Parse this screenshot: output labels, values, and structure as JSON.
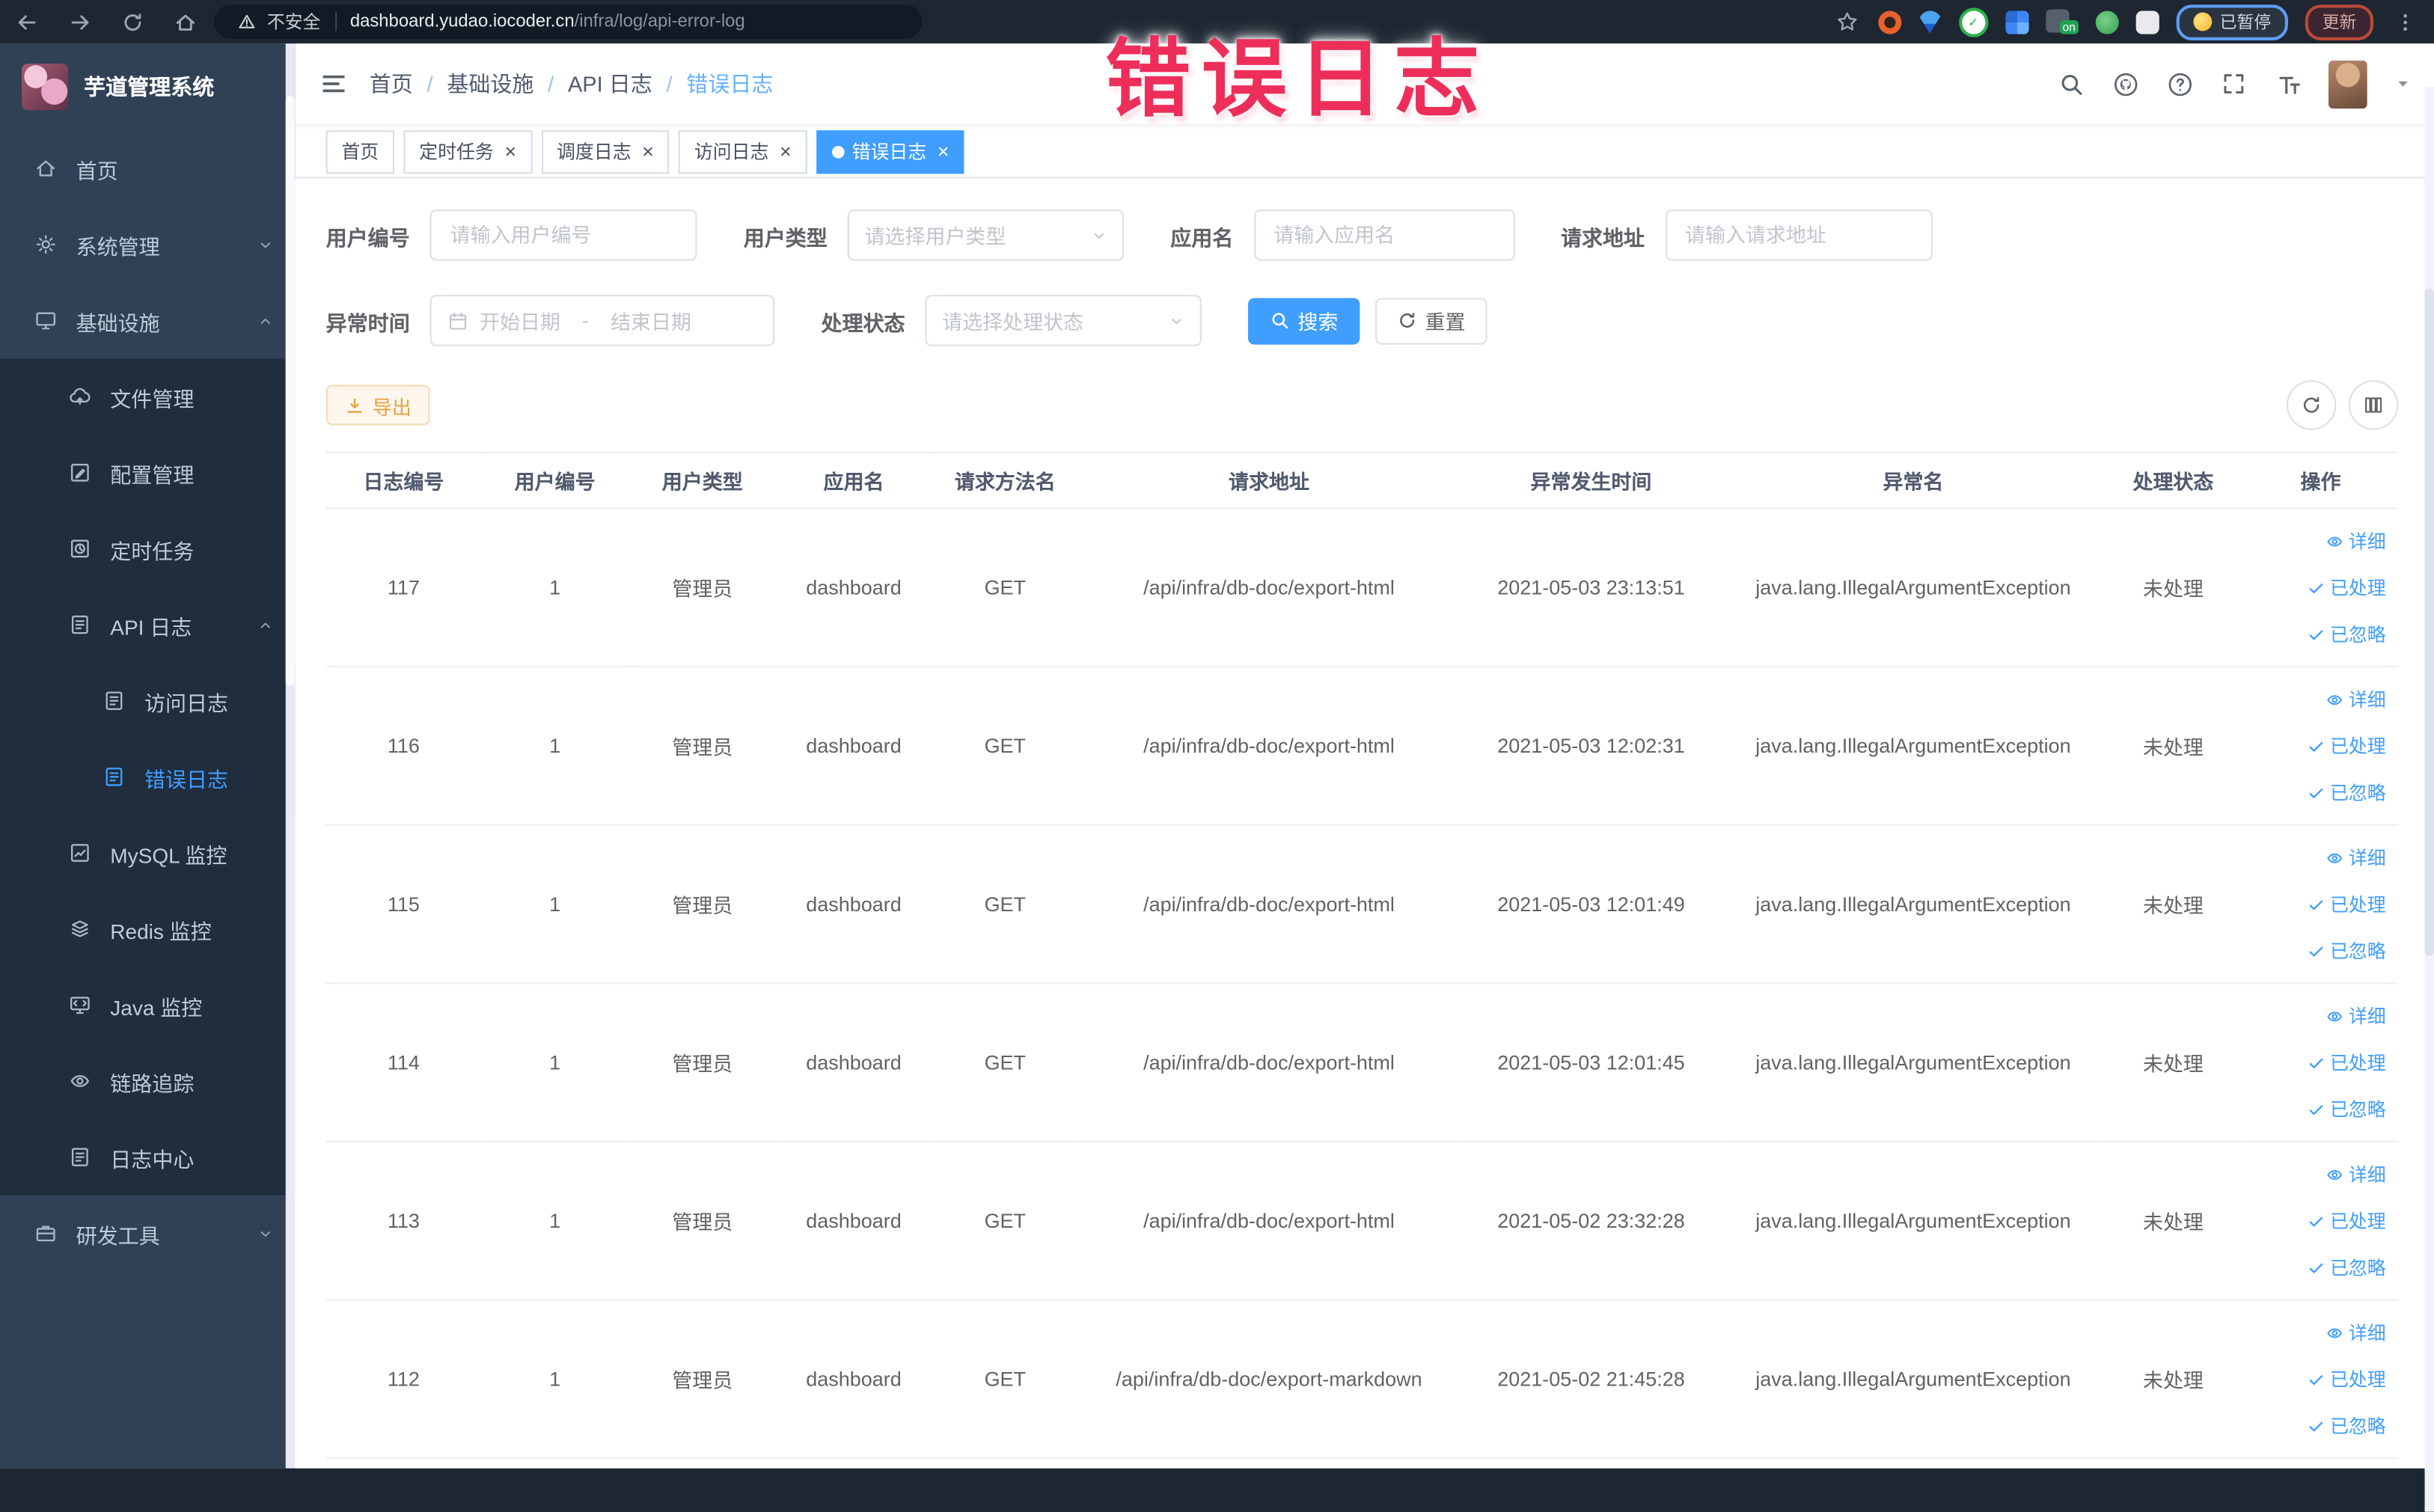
{
  "browser": {
    "security_label": "不安全",
    "url_host": "dashboard.yudao.iocoder.cn",
    "url_path": "/infra/log/api-error-log",
    "paused_button": "已暂停",
    "update_button": "更新",
    "extension_badge": "on"
  },
  "watermark": "错误日志",
  "sidebar": {
    "title": "芋道管理系统",
    "items": [
      {
        "name": "home",
        "icon": "home-icon",
        "label": "首页"
      },
      {
        "name": "system",
        "icon": "gear-icon",
        "label": "系统管理",
        "chevron": "down"
      },
      {
        "name": "infra",
        "icon": "infra-icon",
        "label": "基础设施",
        "chevron": "up",
        "children": [
          {
            "name": "file",
            "icon": "file-icon",
            "label": "文件管理"
          },
          {
            "name": "config",
            "icon": "config-icon",
            "label": "配置管理"
          },
          {
            "name": "job",
            "icon": "job-icon",
            "label": "定时任务"
          },
          {
            "name": "api-log",
            "icon": "api-log-icon",
            "label": "API 日志",
            "chevron": "up",
            "children": [
              {
                "name": "access-log",
                "icon": "access-log-icon",
                "label": "访问日志"
              },
              {
                "name": "error-log",
                "icon": "error-log-icon",
                "label": "错误日志",
                "active": true
              }
            ]
          },
          {
            "name": "mysql",
            "icon": "mysql-icon",
            "label": "MySQL 监控"
          },
          {
            "name": "redis",
            "icon": "redis-icon",
            "label": "Redis 监控"
          },
          {
            "name": "java",
            "icon": "java-icon",
            "label": "Java 监控"
          },
          {
            "name": "trace",
            "icon": "trace-icon",
            "label": "链路追踪"
          },
          {
            "name": "log-center",
            "icon": "log-center-icon",
            "label": "日志中心"
          }
        ]
      },
      {
        "name": "dev-tools",
        "icon": "dev-tools-icon",
        "label": "研发工具",
        "chevron": "down"
      }
    ]
  },
  "header": {
    "breadcrumb": [
      "首页",
      "基础设施",
      "API 日志",
      "错误日志"
    ]
  },
  "tabs": [
    {
      "label": "首页",
      "active": false,
      "closable": false
    },
    {
      "label": "定时任务",
      "active": false,
      "closable": true
    },
    {
      "label": "调度日志",
      "active": false,
      "closable": true
    },
    {
      "label": "访问日志",
      "active": false,
      "closable": true
    },
    {
      "label": "错误日志",
      "active": true,
      "closable": true
    }
  ],
  "filters": {
    "user_id": {
      "label": "用户编号",
      "placeholder": "请输入用户编号"
    },
    "user_type": {
      "label": "用户类型",
      "placeholder": "请选择用户类型"
    },
    "app_name": {
      "label": "应用名",
      "placeholder": "请输入应用名"
    },
    "request_url": {
      "label": "请求地址",
      "placeholder": "请输入请求地址"
    },
    "exception_time": {
      "label": "异常时间",
      "start_placeholder": "开始日期",
      "separator": "-",
      "end_placeholder": "结束日期"
    },
    "status": {
      "label": "处理状态",
      "placeholder": "请选择处理状态"
    },
    "search_button": "搜索",
    "reset_button": "重置",
    "export_button": "导出"
  },
  "table": {
    "headers": [
      "日志编号",
      "用户编号",
      "用户类型",
      "应用名",
      "请求方法名",
      "请求地址",
      "异常发生时间",
      "异常名",
      "处理状态",
      "操作"
    ],
    "action_labels": [
      "详细",
      "已处理",
      "已忽略"
    ],
    "rows": [
      {
        "id": "117",
        "user_id": "1",
        "user_type": "管理员",
        "app_name": "dashboard",
        "method": "GET",
        "url": "/api/infra/db-doc/export-html",
        "time": "2021-05-03 23:13:51",
        "exception": "java.lang.IllegalArgumentException",
        "status": "未处理",
        "actions": [
          "详细",
          "已处理",
          "已忽略"
        ]
      },
      {
        "id": "116",
        "user_id": "1",
        "user_type": "管理员",
        "app_name": "dashboard",
        "method": "GET",
        "url": "/api/infra/db-doc/export-html",
        "time": "2021-05-03 12:02:31",
        "exception": "java.lang.IllegalArgumentException",
        "status": "未处理",
        "actions": [
          "详细",
          "已处理",
          "已忽略"
        ]
      },
      {
        "id": "115",
        "user_id": "1",
        "user_type": "管理员",
        "app_name": "dashboard",
        "method": "GET",
        "url": "/api/infra/db-doc/export-html",
        "time": "2021-05-03 12:01:49",
        "exception": "java.lang.IllegalArgumentException",
        "status": "未处理",
        "actions": [
          "详细",
          "已处理",
          "已忽略"
        ]
      },
      {
        "id": "114",
        "user_id": "1",
        "user_type": "管理员",
        "app_name": "dashboard",
        "method": "GET",
        "url": "/api/infra/db-doc/export-html",
        "time": "2021-05-03 12:01:45",
        "exception": "java.lang.IllegalArgumentException",
        "status": "未处理",
        "actions": [
          "详细",
          "已处理",
          "已忽略"
        ]
      },
      {
        "id": "113",
        "user_id": "1",
        "user_type": "管理员",
        "app_name": "dashboard",
        "method": "GET",
        "url": "/api/infra/db-doc/export-html",
        "time": "2021-05-02 23:32:28",
        "exception": "java.lang.IllegalArgumentException",
        "status": "未处理",
        "actions": [
          "详细",
          "已处理",
          "已忽略"
        ]
      },
      {
        "id": "112",
        "user_id": "1",
        "user_type": "管理员",
        "app_name": "dashboard",
        "method": "GET",
        "url": "/api/infra/db-doc/export-markdown",
        "time": "2021-05-02 21:45:28",
        "exception": "java.lang.IllegalArgumentException",
        "status": "未处理",
        "actions": [
          "详细",
          "已处理",
          "已忽略"
        ]
      }
    ]
  },
  "colors": {
    "primary": "#409eff",
    "warning": "#e6a23c",
    "sidebar_bg": "#304156",
    "submenu_bg": "#1f2d3d",
    "watermark": "#ee2e5a"
  }
}
